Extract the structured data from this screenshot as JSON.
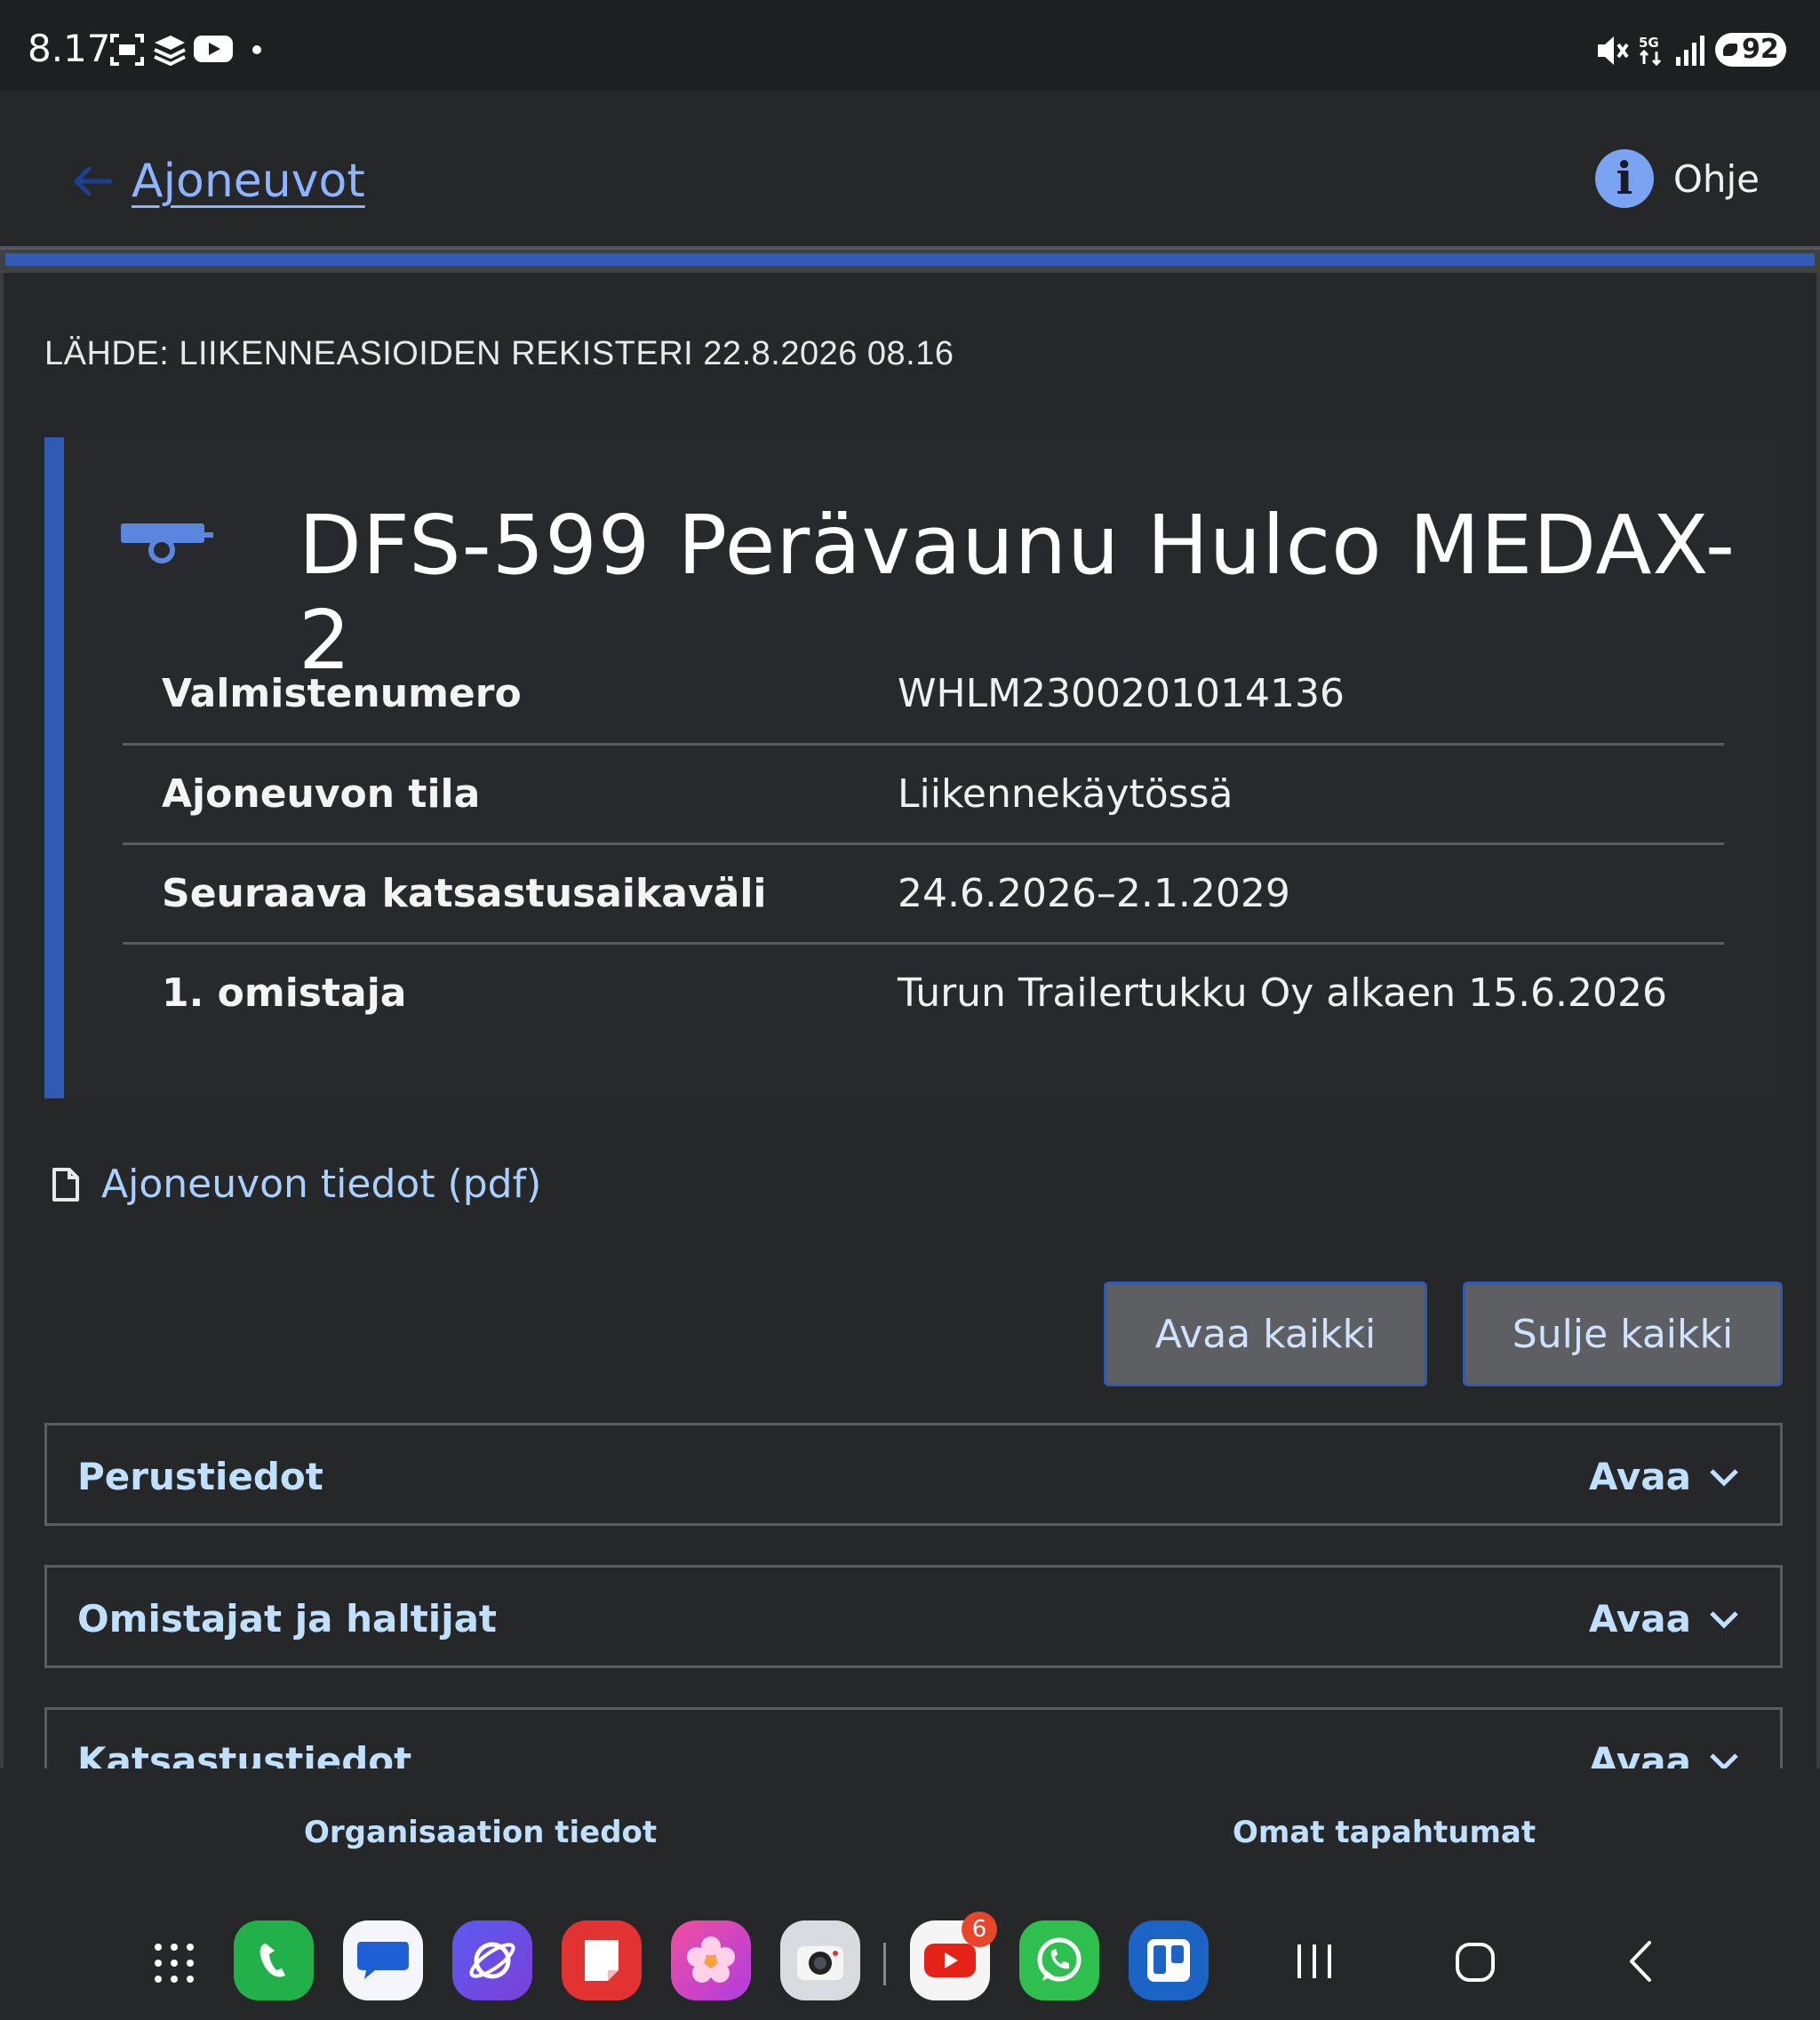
{
  "status_bar": {
    "time": "8.17",
    "network": "5G",
    "battery": "92"
  },
  "header": {
    "back_label": "Ajoneuvot",
    "help_label": "Ohje",
    "help_icon_glyph": "i"
  },
  "main": {
    "source": "LÄHDE: LIIKENNEASIOIDEN REKISTERI 22.8.2026 08.16",
    "vehicle": {
      "title": "DFS-599 Perävaunu Hulco MEDAX-2",
      "icon": "trailer-icon",
      "rows": [
        {
          "label": "Valmistenumero",
          "value": "WHLM2300201014136"
        },
        {
          "label": "Ajoneuvon tila",
          "value": "Liikennekäytössä"
        },
        {
          "label": "Seuraava katsastusaikaväli",
          "value": "24.6.2026–2.1.2029"
        },
        {
          "label": "1. omistaja",
          "value": "Turun Trailertukku Oy alkaen 15.6.2026"
        }
      ]
    },
    "pdf_link": "Ajoneuvon tiedot (pdf)",
    "open_all": "Avaa kaikki",
    "close_all": "Sulje kaikki",
    "accordions": [
      {
        "title": "Perustiedot",
        "toggle": "Avaa"
      },
      {
        "title": "Omistajat ja haltijat",
        "toggle": "Avaa"
      },
      {
        "title": "Katsastustiedot",
        "toggle": "Avaa"
      }
    ]
  },
  "bottom_nav": {
    "left": "Organisaation tiedot",
    "right": "Omat tapahtumat"
  },
  "dock": {
    "apps": [
      "app-drawer",
      "phone",
      "messages",
      "internet",
      "notes",
      "gallery",
      "camera",
      "youtube",
      "whatsapp",
      "trello"
    ],
    "youtube_badge": "6"
  },
  "colors": {
    "accent_blue": "#2f5bb5",
    "link_blue": "#8fb4ff",
    "background": "#262729"
  }
}
